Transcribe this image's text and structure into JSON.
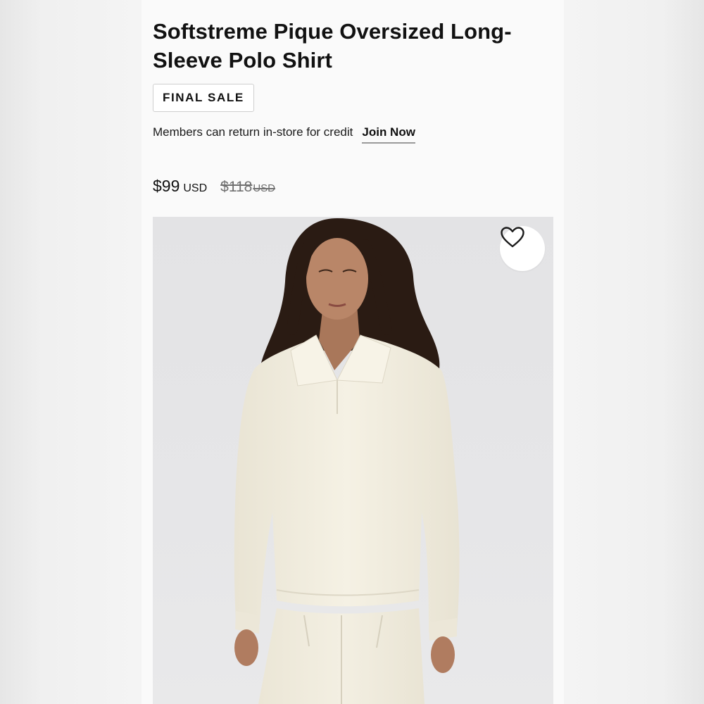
{
  "product": {
    "title": "Softstreme Pique Oversized Long-Sleeve Polo Shirt",
    "badge": "FINAL SALE",
    "members_text": "Members can return in-store for credit",
    "join_label": "Join Now",
    "price": {
      "current": "$99",
      "current_currency": "USD",
      "original": "$118",
      "original_currency": "USD"
    },
    "image": {
      "alt": "Model wearing cream oversized long-sleeve polo shirt",
      "wishlist_icon": "heart-outline-icon"
    }
  },
  "colors": {
    "text": "#111111",
    "muted_price": "#6f6f6f",
    "garment": "#f2eee1",
    "backdrop": "#e5e5e7"
  }
}
